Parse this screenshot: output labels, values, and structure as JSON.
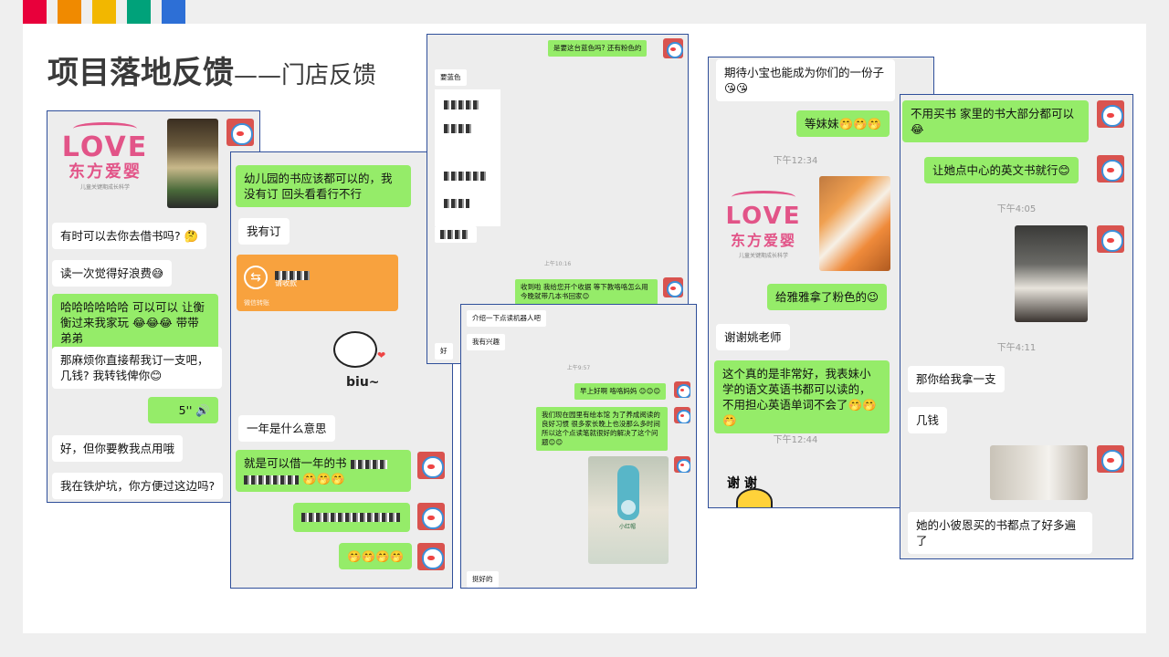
{
  "colors": {
    "stripes": [
      "#e8003b",
      "#f08a00",
      "#f2b700",
      "#00a27a",
      "#2d6fd6"
    ],
    "chat_green": "#95ec69",
    "panel_border": "#2f4f9a",
    "brand_pink": "#e25488",
    "transfer_orange": "#f8a23e"
  },
  "title": {
    "main": "项目落地反馈",
    "sub": "——门店反馈"
  },
  "logo": {
    "text": "LOVE",
    "cn": "东方爱婴",
    "tag": "儿童关键期成长科学"
  },
  "chat1": {
    "m1": "有时可以去你去借书吗? 🤔",
    "m2": "读一次觉得好浪费😅",
    "m3": "哈哈哈哈哈哈 可以可以 让衡衡过来我家玩 😂😂😂 带带弟弟",
    "m4": "那麻烦你直接帮我订一支吧，几钱? 我转钱俾你😊",
    "voice": "5''",
    "m5": "好，但你要教我点用哦",
    "m6": "我在铁炉坑，你方便过这边吗?"
  },
  "chat2": {
    "m1": "幼儿园的书应该都可以的，我没有订 回头看看行不行",
    "m2": "我有订",
    "transfer_status": "请收款",
    "transfer_footer": "微信转账",
    "sticker": "biu~",
    "m3": "一年是什么意思",
    "m4": "就是可以借一年的书",
    "m6": "🤭🤭🤭🤭"
  },
  "chat3": {
    "m1": "是要这台蓝色吗? 还有粉色的",
    "m2": "要蓝色",
    "time": "上午10:16",
    "m3": "收到啦 我给您开个收据 等下教咯咯怎么用 今晚就带几本书回家😊",
    "m4": "好"
  },
  "chat4": {
    "m1": "介绍一下点读机器人吧",
    "m2": "我有兴趣",
    "time": "上午9:57",
    "m3": "早上好啊 咯咯妈妈 😊😊😊",
    "m4": "我们现在园里有绘本馆 为了养成阅读的良好习惯 很多家长晚上也没那么多时间 所以这个点读笔就很好的解决了这个问题😊😊",
    "book": "小红帽",
    "m5": "挺好的"
  },
  "chat5": {
    "m1": "期待小宝也能成为你们的一份子 😘😘",
    "m2": "等妹妹🤭🤭🤭",
    "time1": "下午12:34",
    "m3": "给雅雅拿了粉色的😉",
    "m4": "谢谢姚老师",
    "m5": "这个真的是非常好，我表妹小学的语文英语书都可以读的，不用担心英语单词不会了🤭🤭🤭",
    "time2": "下午12:44",
    "sticker": "谢 谢"
  },
  "chat6": {
    "m1": "不用买书 家里的书大部分都可以😂",
    "m2": "让她点中心的英文书就行😊",
    "time1": "下午4:05",
    "time2": "下午4:11",
    "m3": "那你给我拿一支",
    "m4": "几钱",
    "m5": "她的小彼恩买的书都点了好多遍了"
  }
}
